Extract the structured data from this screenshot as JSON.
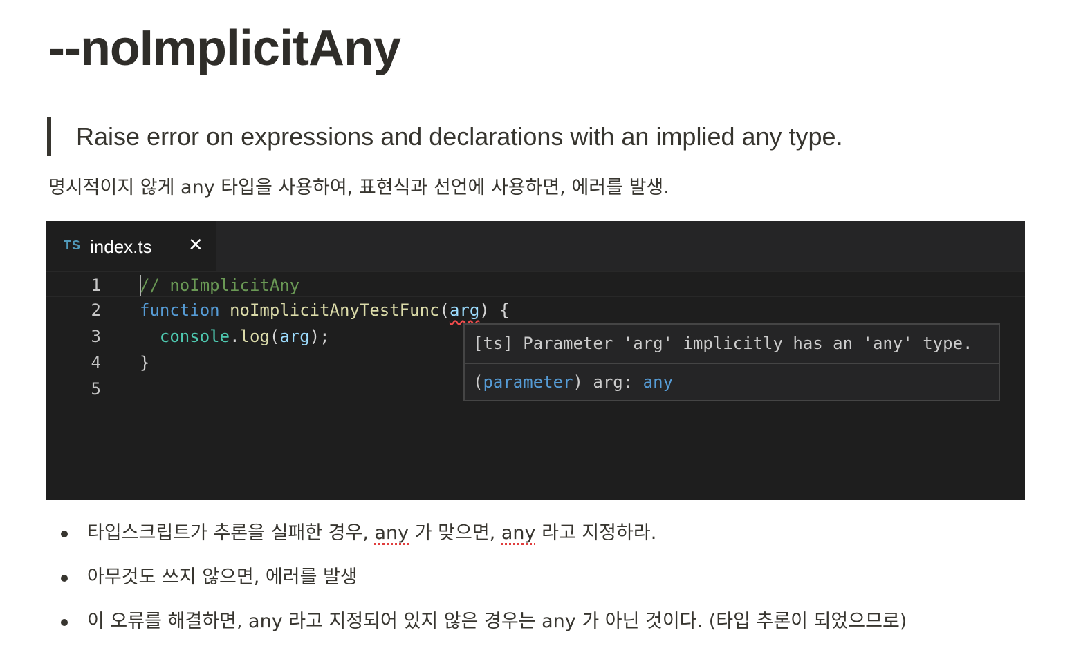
{
  "page": {
    "title": "--noImplicitAny",
    "quote": "Raise error on expressions and declarations with an implied any type.",
    "description": "명시적이지 않게 any 타입을 사용하여, 표현식과 선언에 사용하면, 에러를 발생."
  },
  "editor": {
    "tab": {
      "icon_text": "TS",
      "label": "index.ts",
      "close_glyph": "✕",
      "icon": "typescript-file-icon"
    },
    "lines": [
      {
        "number": "1",
        "comment": "// noImplicitAny"
      },
      {
        "number": "2",
        "keyword": "function",
        "space1": " ",
        "fn_name": "noImplicitAnyTestFunc",
        "open_paren": "(",
        "param": "arg",
        "close": ") {"
      },
      {
        "number": "3",
        "indent": "  ",
        "object": "console",
        "dot": ".",
        "method": "log",
        "open_paren": "(",
        "arg": "arg",
        "close": ");"
      },
      {
        "number": "4",
        "brace": "}"
      },
      {
        "number": "5"
      }
    ],
    "hover": {
      "message": "[ts] Parameter 'arg' implicitly has an 'any' type.",
      "open_paren": "(",
      "kind": "parameter",
      "close_paren": ") ",
      "name": "arg",
      "colon": ": ",
      "type": "any"
    }
  },
  "bullets": [
    {
      "part1": "타입스크립트가 추론을 실패한 경우, ",
      "word1": "any",
      "part2": " 가 맞으면, ",
      "word2": "any",
      "part3": " 라고 지정하라."
    },
    {
      "text": "아무것도 쓰지 않으면, 에러를 발생"
    },
    {
      "text": "이 오류를 해결하면, any 라고 지정되어 있지 않은 경우는 any 가 아닌 것이다. (타입 추론이 되었으므로)"
    }
  ],
  "colors": {
    "editor_bg": "#1e1e1e",
    "tabbar_bg": "#252526",
    "comment": "#6a9955",
    "keyword": "#569cd6",
    "function": "#dcdcaa",
    "variable": "#9cdcfe",
    "object": "#4ec9b0",
    "error_squiggle": "#f14c4c"
  }
}
